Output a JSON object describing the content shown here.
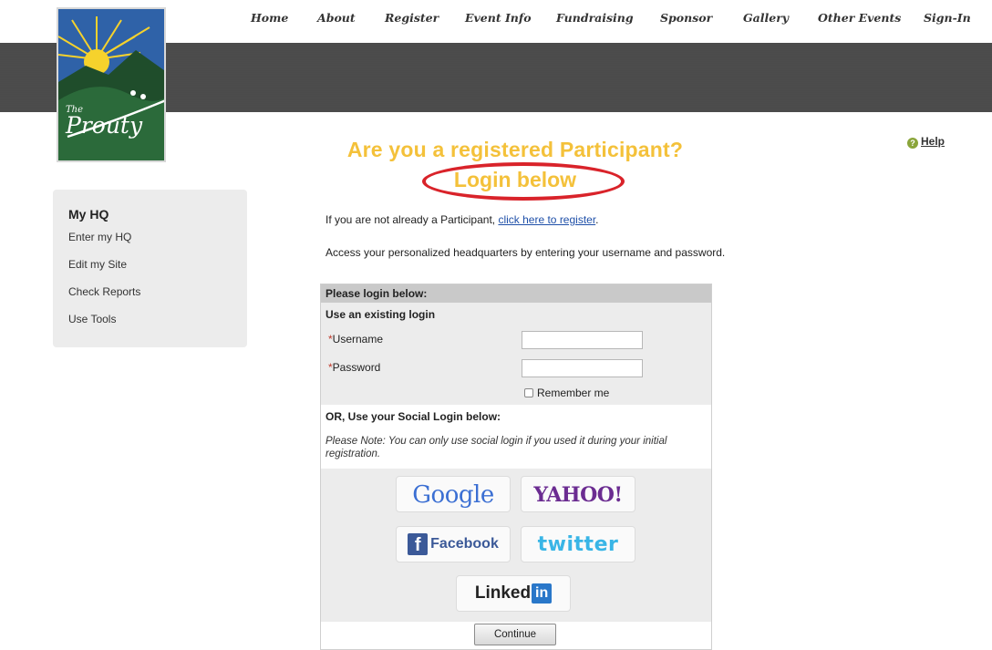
{
  "nav": {
    "items": [
      "Home",
      "About",
      "Register",
      "Event Info",
      "Fundraising",
      "Sponsor",
      "Gallery",
      "Other Events",
      "Sign-In"
    ]
  },
  "logo": {
    "the": "The",
    "name": "Prouty"
  },
  "sidebar": {
    "title": "My HQ",
    "items": [
      "Enter my HQ",
      "Edit my Site",
      "Check Reports",
      "Use Tools"
    ]
  },
  "headline": "Are you a registered Participant?",
  "subhead": "Login below",
  "help": {
    "label": "Help",
    "icon": "help-icon"
  },
  "intro": {
    "not_participant": "If you are not already a Participant,",
    "register_link": "click here to register",
    "trailing": ".",
    "access_text": "Access your personalized headquarters by entering your username and password."
  },
  "login": {
    "header": "Please login below:",
    "existing_title": "Use an existing login",
    "required_mark": "*",
    "username_label": "Username",
    "username_value": "",
    "password_label": "Password",
    "password_value": "",
    "remember_label": "Remember me",
    "remember_checked": false,
    "social_title": "OR, Use your Social Login below:",
    "social_note": "Please Note: You can only use social login if you used it during your initial registration.",
    "continue_label": "Continue"
  },
  "social": {
    "google": "Google",
    "yahoo": "YAHOO!",
    "facebook_icon": "f",
    "facebook": "Facebook",
    "twitter": "twitter",
    "linkedin": "Linked",
    "linkedin_in": "in"
  },
  "colors": {
    "headline": "#f4c13a",
    "highlight_oval": "#d9232a",
    "link": "#1e4fa8",
    "logo_green": "#1f4d2b"
  }
}
